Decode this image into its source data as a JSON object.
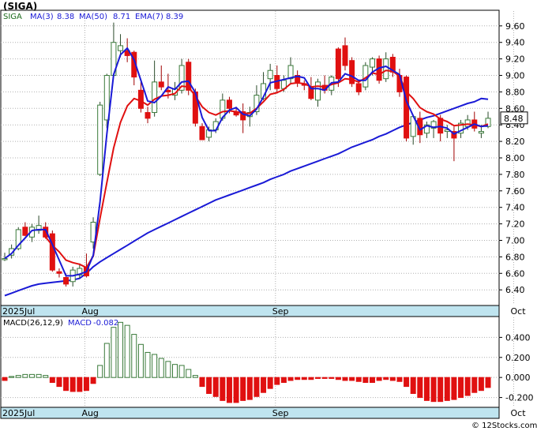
{
  "chart_data": [
    {
      "type": "candlestick",
      "title": "(SIGA)",
      "ticker": "SIGA",
      "legend": [
        {
          "name": "MA(3)",
          "value": "8.38",
          "color": "#1a1ad6"
        },
        {
          "name": "MA(50)",
          "value": "8.71",
          "color": "#1a1ad6"
        },
        {
          "name": "EMA(7)",
          "value": "8.39",
          "color": "#1a1ad6"
        }
      ],
      "x_labels": [
        "2025Jul",
        "Aug",
        "Sep",
        "Oct"
      ],
      "x_label_index": [
        0,
        12,
        40,
        75
      ],
      "y_ticks": [
        6.4,
        6.6,
        6.8,
        7.0,
        7.2,
        7.4,
        7.6,
        7.8,
        8.0,
        8.2,
        8.4,
        8.6,
        8.8,
        9.0,
        9.2,
        9.4,
        9.6
      ],
      "y_tick_labels": [
        "6.40",
        "6.60",
        "6.80",
        "7.00",
        "7.20",
        "7.40",
        "7.60",
        "7.80",
        "8.00",
        "8.20",
        "8.40",
        "8.60",
        "8.80",
        "9.00",
        "9.20",
        "9.40",
        "9.60"
      ],
      "ylim": [
        6.22,
        9.78
      ],
      "last_price_label": "8.48",
      "up_color": "#3a7a3a",
      "down_color": "#e01010",
      "ma_color": "#1a1ad6",
      "ema_color": "#e01010",
      "candles": [
        [
          6.78,
          6.85,
          6.75,
          6.78
        ],
        [
          6.82,
          6.95,
          6.78,
          6.9
        ],
        [
          6.9,
          7.16,
          6.88,
          7.13
        ],
        [
          7.16,
          7.22,
          7.05,
          7.06
        ],
        [
          7.04,
          7.2,
          6.98,
          7.16
        ],
        [
          7.12,
          7.3,
          7.08,
          7.18
        ],
        [
          7.16,
          7.22,
          7.02,
          7.04
        ],
        [
          7.08,
          7.12,
          6.62,
          6.64
        ],
        [
          6.62,
          6.66,
          6.55,
          6.6
        ],
        [
          6.55,
          6.6,
          6.44,
          6.47
        ],
        [
          6.5,
          6.68,
          6.44,
          6.64
        ],
        [
          6.58,
          6.72,
          6.54,
          6.66
        ],
        [
          6.68,
          6.84,
          6.55,
          6.57
        ],
        [
          6.98,
          7.28,
          6.9,
          7.22
        ],
        [
          7.8,
          8.68,
          7.78,
          8.64
        ],
        [
          8.46,
          9.02,
          8.36,
          9.0
        ],
        [
          9.0,
          9.64,
          8.98,
          9.4
        ],
        [
          9.3,
          9.5,
          9.22,
          9.36
        ],
        [
          9.3,
          9.45,
          9.16,
          9.24
        ],
        [
          9.28,
          9.3,
          8.88,
          8.98
        ],
        [
          8.82,
          8.92,
          8.55,
          8.6
        ],
        [
          8.55,
          8.62,
          8.42,
          8.48
        ],
        [
          8.55,
          9.18,
          8.5,
          8.92
        ],
        [
          8.92,
          9.12,
          8.82,
          8.86
        ],
        [
          8.82,
          9.02,
          8.72,
          8.8
        ],
        [
          8.76,
          8.92,
          8.7,
          8.84
        ],
        [
          8.82,
          9.2,
          8.78,
          9.12
        ],
        [
          9.16,
          9.2,
          8.76,
          8.82
        ],
        [
          8.8,
          8.84,
          8.38,
          8.42
        ],
        [
          8.38,
          8.42,
          8.22,
          8.22
        ],
        [
          8.25,
          8.38,
          8.2,
          8.34
        ],
        [
          8.34,
          8.48,
          8.3,
          8.44
        ],
        [
          8.48,
          8.78,
          8.45,
          8.7
        ],
        [
          8.7,
          8.74,
          8.54,
          8.6
        ],
        [
          8.56,
          8.62,
          8.5,
          8.52
        ],
        [
          8.56,
          8.66,
          8.3,
          8.46
        ],
        [
          8.5,
          8.62,
          8.38,
          8.55
        ],
        [
          8.56,
          8.88,
          8.52,
          8.76
        ],
        [
          8.72,
          9.04,
          8.7,
          8.9
        ],
        [
          8.96,
          9.14,
          8.82,
          9.06
        ],
        [
          9.0,
          9.12,
          8.78,
          8.84
        ],
        [
          8.84,
          9.0,
          8.8,
          8.94
        ],
        [
          8.96,
          9.22,
          8.9,
          9.12
        ],
        [
          9.0,
          9.06,
          8.86,
          8.92
        ],
        [
          8.9,
          8.94,
          8.82,
          8.88
        ],
        [
          8.86,
          8.98,
          8.7,
          8.72
        ],
        [
          8.7,
          8.96,
          8.62,
          8.92
        ],
        [
          8.88,
          9.0,
          8.78,
          8.82
        ],
        [
          8.82,
          9.0,
          8.76,
          8.98
        ],
        [
          9.32,
          9.34,
          8.86,
          8.96
        ],
        [
          9.36,
          9.46,
          9.06,
          9.12
        ],
        [
          9.18,
          9.22,
          8.86,
          8.9
        ],
        [
          8.9,
          8.94,
          8.76,
          8.8
        ],
        [
          8.86,
          9.16,
          8.82,
          9.12
        ],
        [
          9.1,
          9.22,
          9.0,
          9.2
        ],
        [
          9.2,
          9.24,
          8.9,
          8.94
        ],
        [
          8.96,
          9.28,
          8.92,
          9.2
        ],
        [
          9.22,
          9.26,
          8.98,
          9.04
        ],
        [
          9.0,
          9.08,
          8.74,
          8.8
        ],
        [
          8.98,
          9.0,
          8.2,
          8.24
        ],
        [
          8.26,
          8.52,
          8.16,
          8.5
        ],
        [
          8.48,
          8.56,
          8.18,
          8.28
        ],
        [
          8.3,
          8.44,
          8.24,
          8.4
        ],
        [
          8.36,
          8.46,
          8.24,
          8.44
        ],
        [
          8.48,
          8.52,
          8.2,
          8.3
        ],
        [
          8.32,
          8.4,
          8.24,
          8.34
        ],
        [
          8.32,
          8.38,
          7.96,
          8.24
        ],
        [
          8.3,
          8.46,
          8.24,
          8.42
        ],
        [
          8.38,
          8.52,
          8.34,
          8.46
        ],
        [
          8.46,
          8.56,
          8.32,
          8.36
        ],
        [
          8.3,
          8.4,
          8.24,
          8.32
        ],
        [
          8.38,
          8.56,
          8.36,
          8.48
        ]
      ],
      "ma3": [
        6.78,
        6.84,
        6.94,
        7.03,
        7.12,
        7.13,
        7.13,
        6.95,
        6.76,
        6.57,
        6.57,
        6.59,
        6.62,
        6.82,
        7.47,
        8.29,
        9.01,
        9.25,
        9.33,
        9.19,
        8.94,
        8.69,
        8.67,
        8.75,
        8.86,
        8.83,
        8.92,
        8.93,
        8.79,
        8.49,
        8.33,
        8.33,
        8.49,
        8.58,
        8.61,
        8.53,
        8.51,
        8.59,
        8.74,
        8.91,
        8.93,
        8.95,
        8.97,
        8.99,
        8.97,
        8.84,
        8.84,
        8.82,
        8.91,
        8.92,
        9.02,
        8.99,
        8.94,
        8.94,
        9.04,
        9.09,
        9.11,
        9.06,
        9.01,
        8.69,
        8.51,
        8.34,
        8.39,
        8.37,
        8.38,
        8.36,
        8.29,
        8.33,
        8.37,
        8.41,
        8.38,
        8.39
      ],
      "ema7": [
        null,
        null,
        null,
        null,
        null,
        null,
        7.04,
        6.94,
        6.86,
        6.76,
        6.73,
        6.71,
        6.67,
        6.81,
        7.27,
        7.7,
        8.12,
        8.43,
        8.63,
        8.72,
        8.69,
        8.64,
        8.71,
        8.75,
        8.76,
        8.78,
        8.87,
        8.86,
        8.75,
        8.62,
        8.55,
        8.52,
        8.56,
        8.57,
        8.56,
        8.54,
        8.54,
        8.6,
        8.68,
        8.77,
        8.79,
        8.83,
        8.9,
        8.91,
        8.9,
        8.86,
        8.87,
        8.86,
        8.89,
        8.91,
        8.96,
        8.95,
        8.92,
        8.97,
        9.03,
        9.01,
        9.06,
        9.05,
        8.99,
        8.8,
        8.72,
        8.61,
        8.56,
        8.53,
        8.47,
        8.44,
        8.39,
        8.4,
        8.41,
        8.4,
        8.38,
        8.41
      ],
      "ma50": [
        6.33,
        6.36,
        6.39,
        6.42,
        6.45,
        6.47,
        6.48,
        6.49,
        6.5,
        6.51,
        6.52,
        6.54,
        6.6,
        6.68,
        6.74,
        6.79,
        6.84,
        6.89,
        6.94,
        6.99,
        7.04,
        7.09,
        7.13,
        7.17,
        7.21,
        7.25,
        7.29,
        7.33,
        7.37,
        7.41,
        7.45,
        7.49,
        7.52,
        7.55,
        7.58,
        7.61,
        7.64,
        7.67,
        7.7,
        7.74,
        7.77,
        7.8,
        7.84,
        7.87,
        7.9,
        7.93,
        7.96,
        7.99,
        8.02,
        8.05,
        8.09,
        8.13,
        8.16,
        8.19,
        8.22,
        8.26,
        8.29,
        8.33,
        8.37,
        8.4,
        8.43,
        8.46,
        8.49,
        8.51,
        8.54,
        8.57,
        8.6,
        8.63,
        8.66,
        8.68,
        8.72,
        8.71
      ]
    },
    {
      "type": "bar",
      "title": "MACD(26,12,9)",
      "legend": [
        {
          "name": "MACD",
          "value": "-0.082",
          "color": "#1a1ad6"
        }
      ],
      "x_labels": [
        "2025Jul",
        "Aug",
        "Sep",
        "Oct"
      ],
      "y_ticks": [
        -0.2,
        0.0,
        0.2,
        0.4
      ],
      "y_tick_labels": [
        "-0.200",
        "0.000",
        "0.200",
        "0.400"
      ],
      "ylim": [
        -0.29,
        0.6
      ],
      "values": [
        -0.03,
        0.01,
        0.02,
        0.03,
        0.03,
        0.03,
        0.02,
        -0.05,
        -0.09,
        -0.13,
        -0.14,
        -0.14,
        -0.13,
        -0.06,
        0.12,
        0.34,
        0.5,
        0.55,
        0.52,
        0.43,
        0.33,
        0.25,
        0.23,
        0.19,
        0.16,
        0.13,
        0.12,
        0.08,
        0.02,
        -0.09,
        -0.16,
        -0.19,
        -0.23,
        -0.25,
        -0.25,
        -0.23,
        -0.22,
        -0.19,
        -0.15,
        -0.11,
        -0.07,
        -0.05,
        -0.03,
        -0.02,
        -0.02,
        -0.02,
        -0.01,
        -0.01,
        -0.01,
        -0.02,
        -0.03,
        -0.03,
        -0.04,
        -0.05,
        -0.05,
        -0.03,
        -0.02,
        -0.03,
        -0.04,
        -0.09,
        -0.16,
        -0.2,
        -0.23,
        -0.24,
        -0.24,
        -0.23,
        -0.22,
        -0.2,
        -0.18,
        -0.15,
        -0.13,
        -0.1
      ]
    }
  ],
  "watermark": "© 12Stocks.com"
}
